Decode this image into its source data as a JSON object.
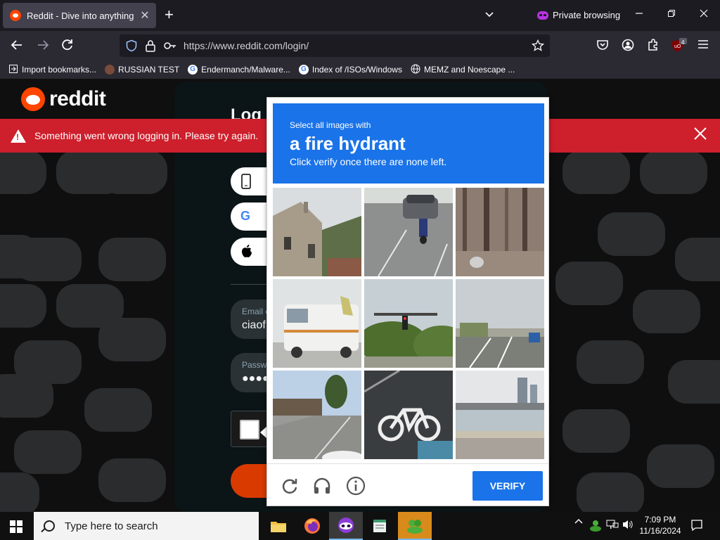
{
  "browser": {
    "tab_title": "Reddit - Dive into anything",
    "tab_close": "✕",
    "new_tab": "+",
    "private_label": "Private browsing",
    "url": "https://www.reddit.com/login/",
    "extension_badge": "4",
    "bookmarks": [
      {
        "label": "Import bookmarks...",
        "icon": "import-icon"
      },
      {
        "label": "RUSSIAN TEST",
        "icon": "site-icon"
      },
      {
        "label": "Endermanch/Malware...",
        "icon": "google-icon"
      },
      {
        "label": "Index of /ISOs/Windows",
        "icon": "google-icon"
      },
      {
        "label": "MEMZ and Noescape ...",
        "icon": "globe-icon"
      }
    ]
  },
  "reddit": {
    "logo_text": "reddit",
    "login_title": "Log",
    "email_label": "Email o",
    "email_value": "ciaof",
    "password_label": "Passwo",
    "password_value": "●●●●"
  },
  "error": {
    "message": "Something went wrong logging in. Please try again."
  },
  "captcha": {
    "instruction_small": "Select all images with",
    "instruction_target": "a fire hydrant",
    "instruction_sub": "Click verify once there are none left.",
    "verify_label": "VERIFY",
    "tiles": [
      "house-street-image",
      "scooter-road-image",
      "trees-forest-image",
      "van-street-image",
      "traffic-light-image",
      "highway-sign-image",
      "street-market-image",
      "bike-lane-image",
      "harbor-bridge-image"
    ]
  },
  "taskbar": {
    "search_placeholder": "Type here to search",
    "time": "7:09 PM",
    "date": "11/16/2024"
  },
  "colors": {
    "reddit_orange": "#ff4500",
    "error_red": "#cd1f2c",
    "captcha_blue": "#1a73e8"
  }
}
